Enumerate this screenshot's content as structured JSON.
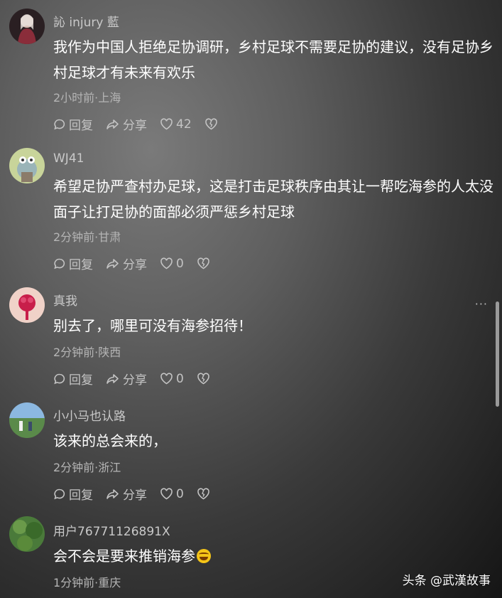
{
  "comments": [
    {
      "username": "訫 injury 藍",
      "text": "我作为中国人拒绝足协调研，乡村足球不需要足协的建议，没有足协乡村足球才有未来有欢乐",
      "meta": "2小时前·上海",
      "reply": "回复",
      "share": "分享",
      "likes": "42"
    },
    {
      "username": "WJ41",
      "text": "希望足协严查村办足球，这是打击足球秩序由其让一帮吃海参的人太没面子让打足协的面部必须严惩乡村足球",
      "meta": "2分钟前·甘肃",
      "reply": "回复",
      "share": "分享",
      "likes": "0"
    },
    {
      "username": "真我",
      "text": "别去了，哪里可没有海参招待！",
      "meta": "2分钟前·陕西",
      "reply": "回复",
      "share": "分享",
      "likes": "0"
    },
    {
      "username": "小小马也认路",
      "text": "该来的总会来的，",
      "meta": "2分钟前·浙江",
      "reply": "回复",
      "share": "分享",
      "likes": "0"
    },
    {
      "username": "用户76771126891X",
      "text": "会不会是要来推销海参",
      "meta": "1分钟前·重庆"
    }
  ],
  "more_menu": "···",
  "watermark": "头条 @武漢故事",
  "icons": [
    "comment-bubble-icon",
    "share-arrow-icon",
    "heart-icon",
    "broken-heart-icon",
    "grin-sweat-emoji-icon"
  ],
  "colors": {
    "text": "#ffffff",
    "meta": "#b5b5b5",
    "username": "#c9c9c9"
  }
}
